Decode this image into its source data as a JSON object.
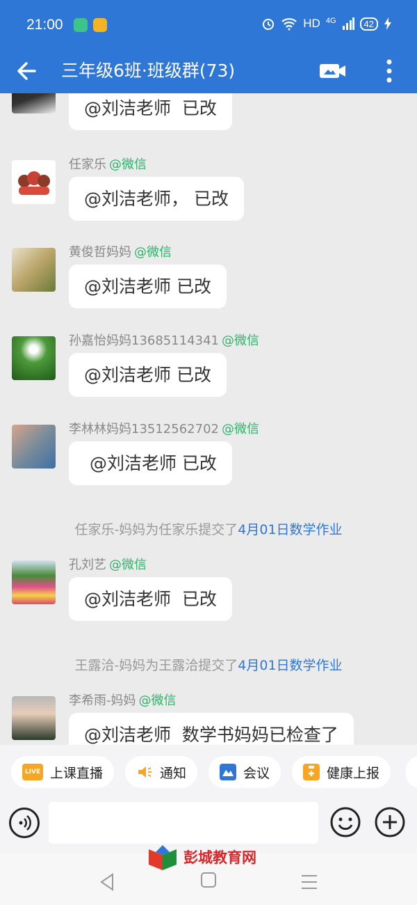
{
  "status_bar": {
    "time": "21:00",
    "network_label": "HD",
    "network_type": "4G",
    "battery": "42"
  },
  "header": {
    "title": "三年级6班·班级群(73)"
  },
  "messages": [
    {
      "sender": "",
      "source": "",
      "text": "@刘洁老师  已改"
    },
    {
      "sender": "任家乐",
      "source": "@微信",
      "text": "@刘洁老师， 已改"
    },
    {
      "sender": "黄俊哲妈妈",
      "source": "@微信",
      "text": "@刘洁老师 已改"
    },
    {
      "sender": "孙嘉怡妈妈13685114341",
      "source": "@微信",
      "text": "@刘洁老师 已改"
    },
    {
      "sender": "李林林妈妈13512562702",
      "source": "@微信",
      "text": " @刘洁老师 已改"
    },
    {
      "sender": "孔刘艺",
      "source": "@微信",
      "text": "@刘洁老师  已改"
    },
    {
      "sender": "李希雨-妈妈",
      "source": "@微信",
      "text": "@刘洁老师  数学书妈妈已检查了"
    }
  ],
  "system_notices": [
    {
      "prefix": "任家乐-妈妈为任家乐提交了",
      "homework": "4月01日数学作业"
    },
    {
      "prefix": "王露洽-妈妈为王露洽提交了",
      "homework": "4月01日数学作业"
    }
  ],
  "quick_actions": [
    {
      "label": "上课直播",
      "icon": "live-icon",
      "icon_text": "LIVE"
    },
    {
      "label": "通知",
      "icon": "speaker-icon"
    },
    {
      "label": "会议",
      "icon": "meeting-icon"
    },
    {
      "label": "健康上报",
      "icon": "health-report-icon"
    }
  ],
  "input": {
    "placeholder": ""
  },
  "watermark": {
    "text": "彭城教育网"
  },
  "colors": {
    "header": "#2f77d6",
    "wechat_source": "#2fb36b",
    "homework_link": "#2f77d6",
    "chat_bg": "#ebebeb"
  }
}
